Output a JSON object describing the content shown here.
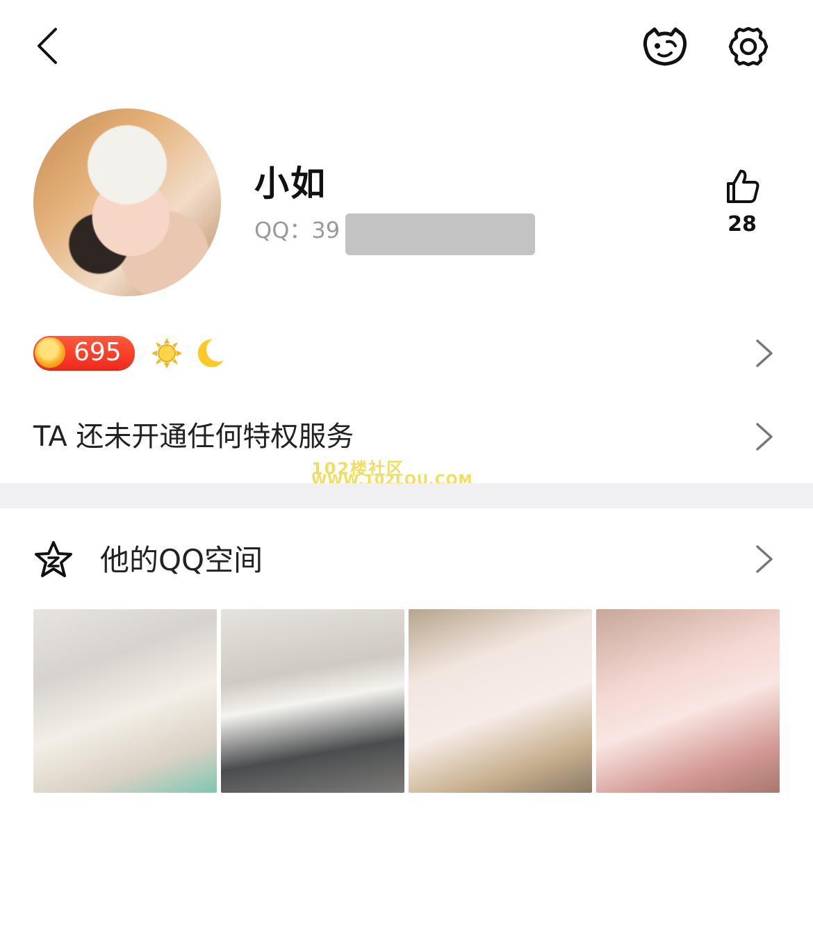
{
  "profile": {
    "nickname": "小如",
    "qq_label": "QQ：39",
    "like_count": "28"
  },
  "level": {
    "value": "695"
  },
  "privilege": {
    "text": "TA 还未开通任何特权服务"
  },
  "qzone": {
    "title": "他的QQ空间"
  },
  "watermark": {
    "line1": "102楼社区",
    "line2": "WWW.102LOU.COM"
  },
  "colors": {
    "badge_red": "#f02b1c",
    "divider": "#f0f0f2",
    "secondary_text": "#9a9a9a"
  }
}
